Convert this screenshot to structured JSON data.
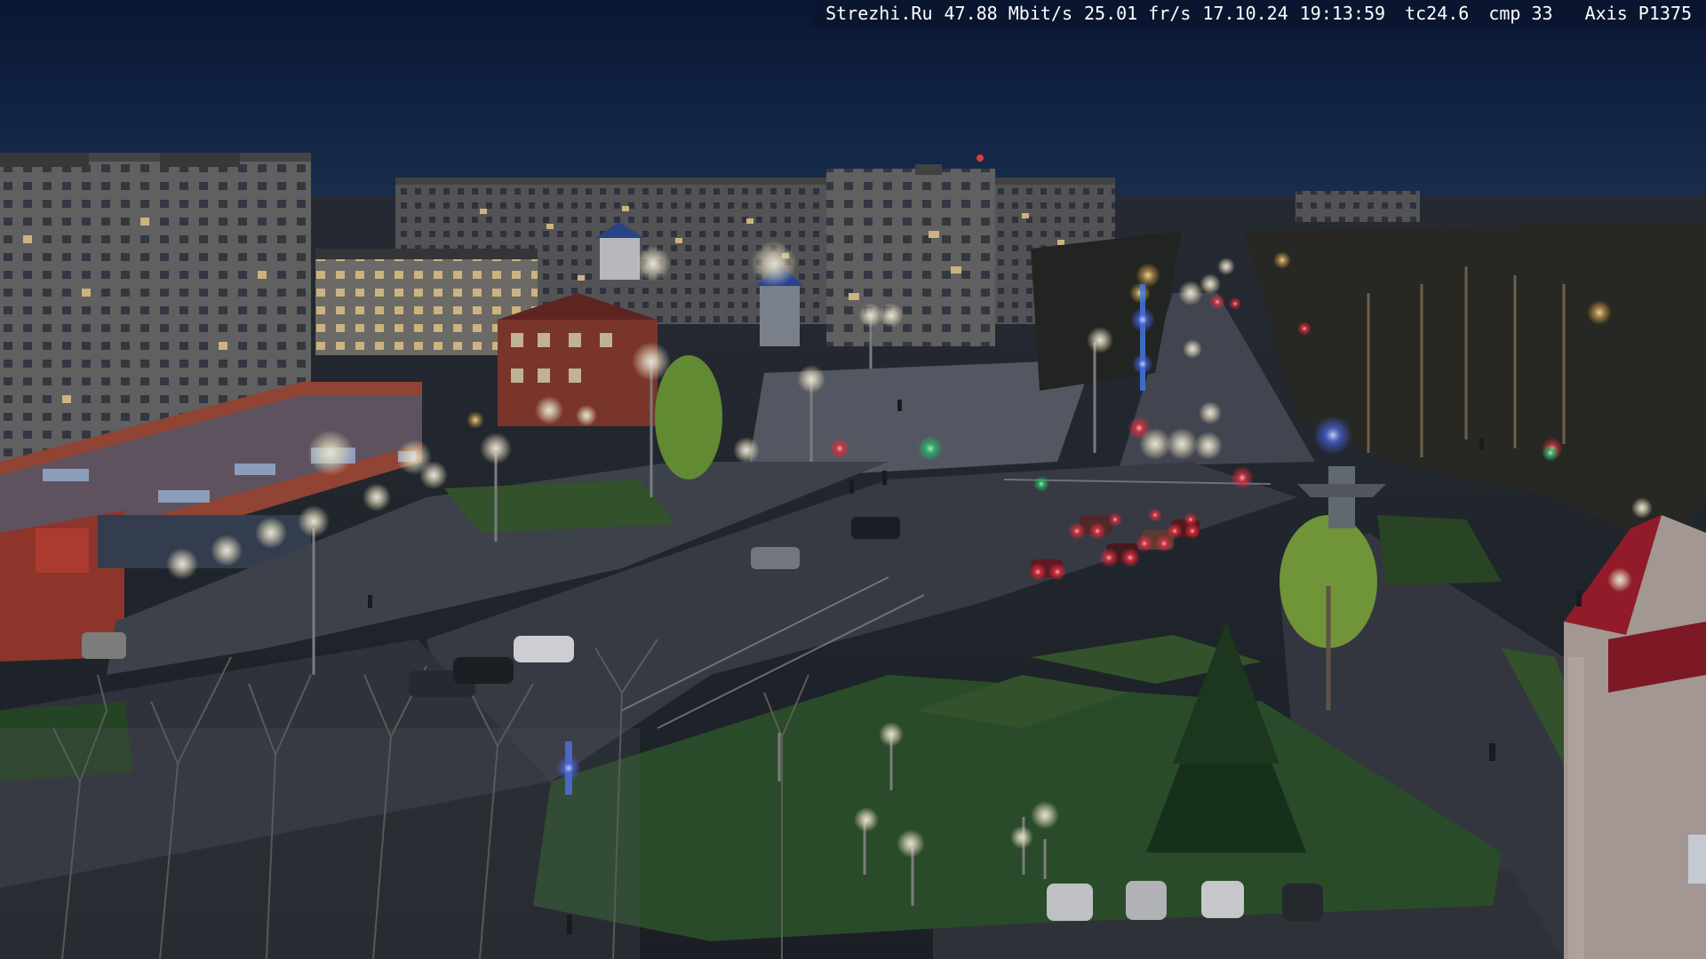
{
  "overlay": {
    "site": "Strezhi.Ru",
    "bitrate": "47.88 Mbit/s",
    "framerate": "25.01 fr/s",
    "date": "17.10.24",
    "time": "19:13:59",
    "tc": "tc24.6",
    "cmp": "cmp 33",
    "camera_model": "Axis P1375"
  },
  "scene": {
    "description_type": "night-city-webcam",
    "colors": {
      "sky_top": "#0b1838",
      "sky_bottom": "#1c3052",
      "road": "#3e3e46",
      "grass": "#2f5228",
      "tail_light": "#ff3040",
      "street_light": "#fff4d8",
      "brick": "#8a3a2a"
    }
  }
}
